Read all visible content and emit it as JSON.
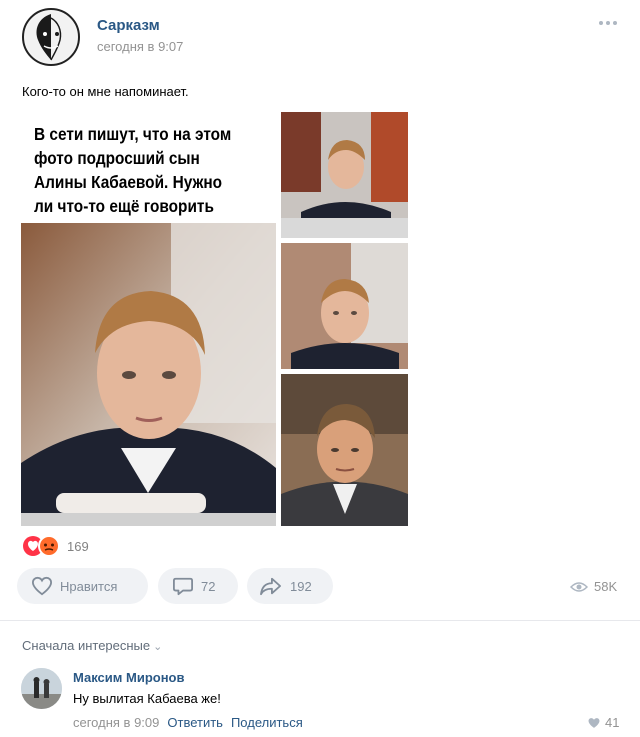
{
  "post": {
    "author": "Сарказм",
    "time": "сегодня в 9:07",
    "text": "Кого-то он мне напоминает.",
    "image_caption": "В сети пишут, что на этом фото подросший сын Алины Кабаевой. Нужно ли что-то ещё говорить",
    "more_icon": "more-dots-icon"
  },
  "reactions": {
    "icons": [
      "heart-eyes-emoji-icon",
      "angry-emoji-icon"
    ],
    "count": "169"
  },
  "actions": {
    "like_label": "Нравится",
    "comment_count": "72",
    "share_count": "192",
    "views": "58K"
  },
  "comments": {
    "sort_label": "Сначала интересные",
    "items": [
      {
        "author": "Максим Миронов",
        "text": "Ну вылитая Кабаева же!",
        "time": "сегодня в 9:09",
        "reply_label": "Ответить",
        "share_label": "Поделиться",
        "likes": "41"
      }
    ]
  },
  "colors": {
    "link": "#2a5885",
    "muted": "#939393",
    "button_bg": "#f0f2f5"
  }
}
